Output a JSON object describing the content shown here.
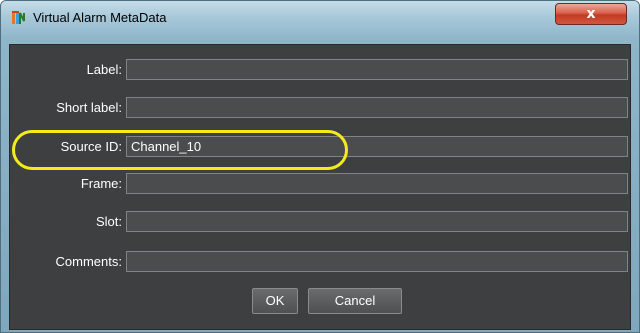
{
  "window": {
    "title": "Virtual Alarm MetaData",
    "close_label": "x"
  },
  "form": {
    "fields": [
      {
        "label": "Label:",
        "value": ""
      },
      {
        "label": "Short label:",
        "value": ""
      },
      {
        "label": "Source ID:",
        "value": "Channel_10"
      },
      {
        "label": "Frame:",
        "value": ""
      },
      {
        "label": "Slot:",
        "value": ""
      },
      {
        "label": "Comments:",
        "value": ""
      }
    ]
  },
  "buttons": {
    "ok": "OK",
    "cancel": "Cancel"
  },
  "colors": {
    "highlight": "#f4ec1a",
    "panel_background": "#3e3f41",
    "close_button": "#c23b22"
  },
  "icons": {
    "app": "app-logo-icon",
    "close": "close-icon"
  }
}
